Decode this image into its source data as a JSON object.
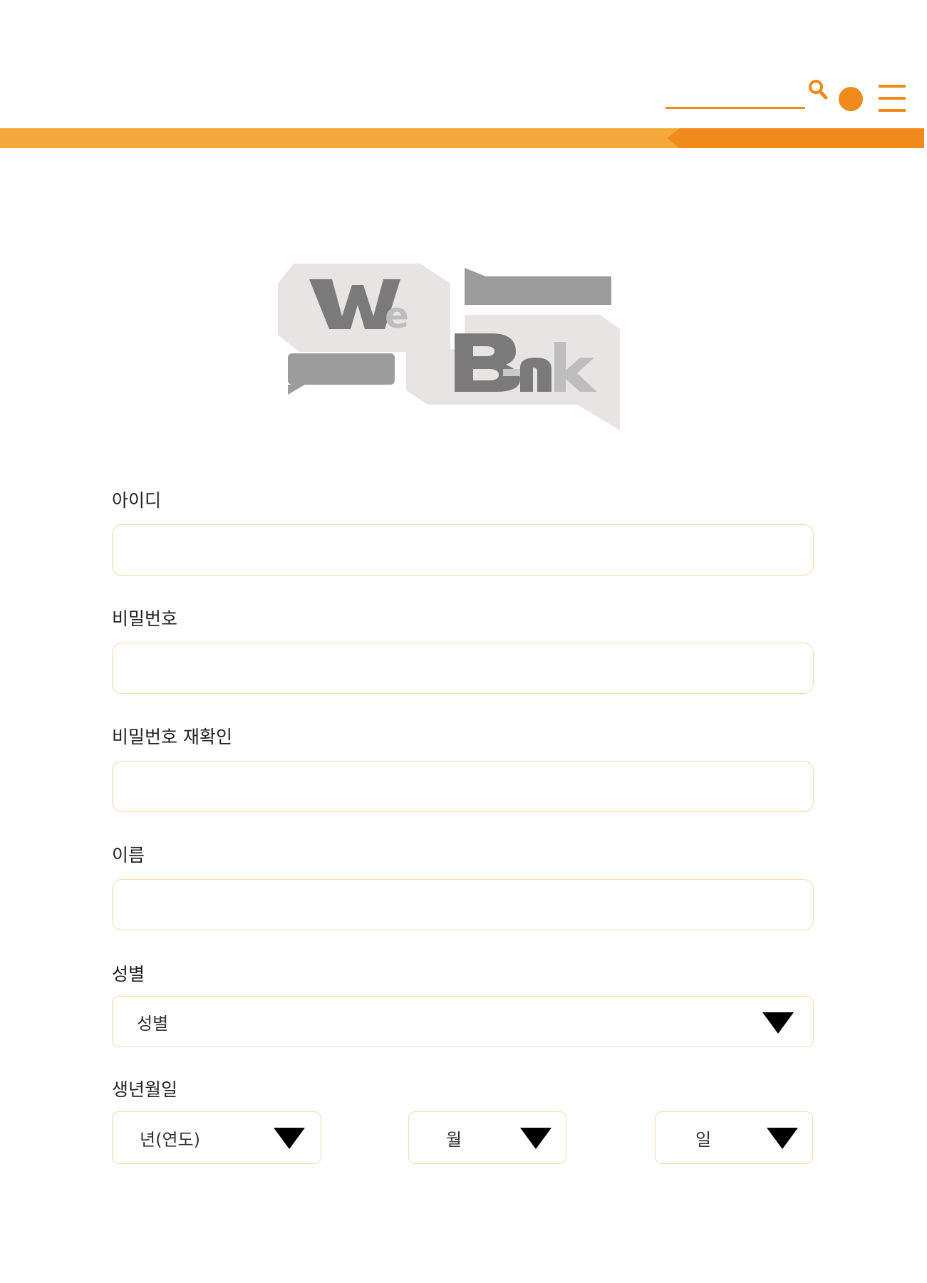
{
  "header": {
    "search": {
      "value": "",
      "placeholder": "",
      "icon": "search-icon"
    },
    "user_icon": "user-circle-icon",
    "menu_icon": "hamburger-menu-icon",
    "accent_color": "#F08A1C",
    "bar_color": "#F5A93A"
  },
  "logo": {
    "text": "WeBank",
    "icon": "webank-speech-bubble-logo"
  },
  "form": {
    "id_field": {
      "label": "아이디",
      "value": "",
      "placeholder": ""
    },
    "password_field": {
      "label": "비밀번호",
      "value": "",
      "placeholder": ""
    },
    "password_confirm_field": {
      "label": "비밀번호 재확인",
      "value": "",
      "placeholder": ""
    },
    "name_field": {
      "label": "이름",
      "value": "",
      "placeholder": ""
    },
    "gender_field": {
      "label": "성별",
      "selected": "성별",
      "icon": "dropdown-arrow-icon"
    },
    "birthdate_field": {
      "label": "생년월일",
      "year_selected": "년(연도)",
      "month_selected": "월",
      "day_selected": "일",
      "icon": "dropdown-arrow-icon"
    },
    "border_color": "#F9D9A8"
  }
}
